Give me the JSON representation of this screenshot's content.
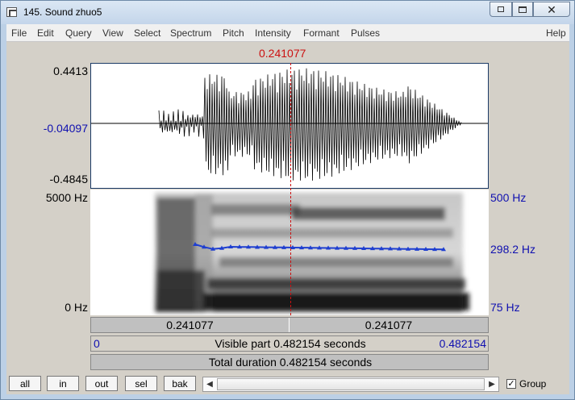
{
  "window": {
    "title": "145. Sound zhuo5"
  },
  "menu": {
    "items": [
      "File",
      "Edit",
      "Query",
      "View",
      "Select",
      "Spectrum",
      "Pitch",
      "Intensity",
      "Formant",
      "Pulses"
    ],
    "help": "Help"
  },
  "cursor": {
    "time_label": "0.241077"
  },
  "waveform": {
    "max_label": "0.4413",
    "zero_label": "-0.04097",
    "min_label": "-0.4845"
  },
  "spectrogram": {
    "freq_top_label": "5000 Hz",
    "freq_bottom_label": "0 Hz",
    "pitch_top_label": "500 Hz",
    "pitch_mid_label": "298.2 Hz",
    "pitch_bottom_label": "75 Hz"
  },
  "time_bars": {
    "left_segment": "0.241077",
    "right_segment": "0.241077",
    "visible_start": "0",
    "visible_text": "Visible part 0.482154 seconds",
    "visible_end": "0.482154",
    "total_text": "Total duration 0.482154 seconds"
  },
  "toolbar": {
    "buttons": [
      "all",
      "in",
      "out",
      "sel",
      "bak"
    ],
    "group_label": "Group",
    "group_checked": true
  },
  "colors": {
    "cursor": "#cc1111",
    "pitch_track": "#1f3fd0",
    "axis_blue": "#1010b0"
  }
}
